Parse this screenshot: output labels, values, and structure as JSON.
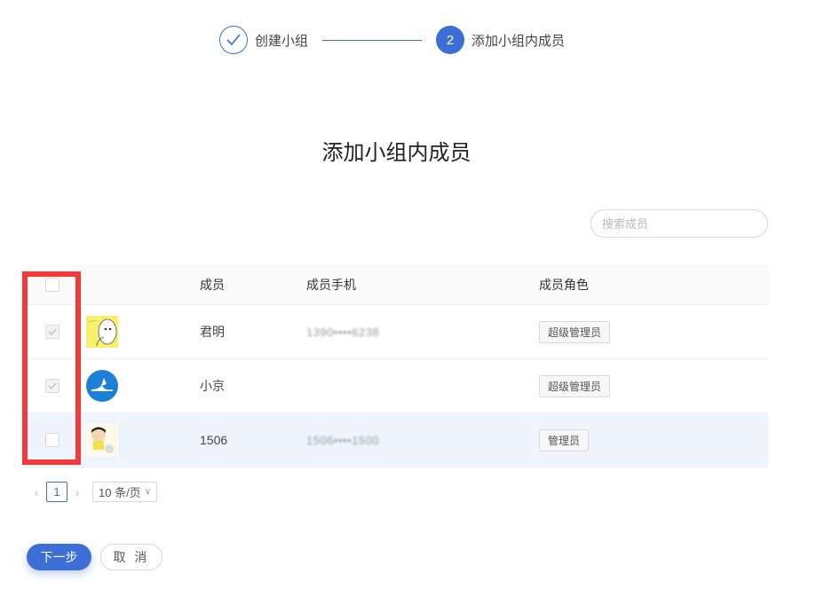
{
  "steps": [
    {
      "label": "创建小组",
      "status": "done"
    },
    {
      "number": "2",
      "label": "添加小组内成员",
      "status": "active"
    }
  ],
  "title": "添加小组内成员",
  "search": {
    "placeholder": "搜索成员"
  },
  "table": {
    "headers": {
      "member": "成员",
      "phone": "成员手机",
      "role": "成员角色"
    },
    "rows": [
      {
        "name": "君明",
        "phone": "1390••••6238",
        "role": "超级管理员",
        "checked": true
      },
      {
        "name": "小京",
        "phone": "",
        "role": "超级管理员",
        "checked": true
      },
      {
        "name": "1506",
        "phone": "1506••••1500",
        "role": "管理员",
        "checked": false
      }
    ]
  },
  "pagination": {
    "current": "1",
    "page_size": "10 条/页"
  },
  "buttons": {
    "next": "下一步",
    "cancel": "取 消"
  },
  "colors": {
    "accent": "#3b6fd6",
    "highlight": "#f23a3a",
    "row_highlight": "#eef5ff"
  }
}
